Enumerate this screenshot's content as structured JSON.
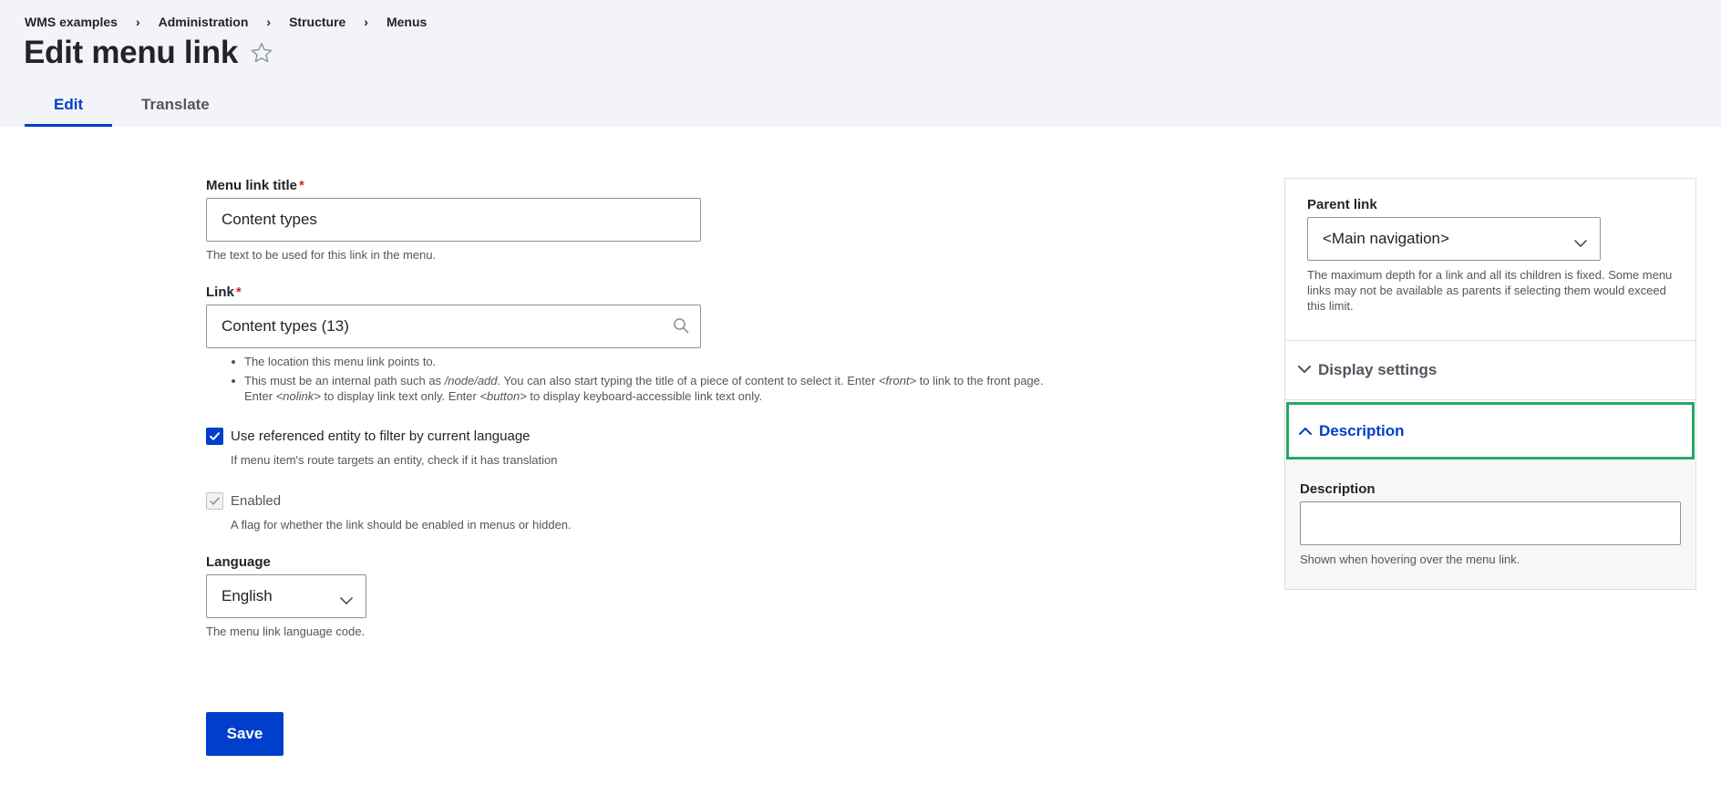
{
  "breadcrumb": [
    "WMS examples",
    "Administration",
    "Structure",
    "Menus"
  ],
  "breadcrumb_separator": "›",
  "page_title": "Edit menu link",
  "tabs": [
    {
      "label": "Edit",
      "active": true
    },
    {
      "label": "Translate",
      "active": false
    }
  ],
  "fields": {
    "title": {
      "label": "Menu link title",
      "required_mark": "*",
      "value": "Content types",
      "help": "The text to be used for this link in the menu."
    },
    "link": {
      "label": "Link",
      "required_mark": "*",
      "value": "Content types (13)",
      "help_items": [
        "The location this menu link points to.",
        "This must be an internal path such as /node/add. You can also start typing the title of a piece of content to select it. Enter <front> to link to the front page.",
        "Enter <nolink> to display link text only. Enter <button> to display keyboard-accessible link text only."
      ],
      "help_parts": {
        "line1": "The location this menu link points to.",
        "line2_a": "This must be an internal path such as ",
        "line2_em1": "/node/add",
        "line2_b": ". You can also start typing the title of a piece of content to select it. Enter ",
        "line2_em2": "<front>",
        "line2_c": " to link to the front page.",
        "line3_a": "Enter ",
        "line3_em1": "<nolink>",
        "line3_b": " to display link text only. Enter ",
        "line3_em2": "<button>",
        "line3_c": " to display keyboard-accessible link text only."
      }
    },
    "use_entity": {
      "label": "Use referenced entity to filter by current language",
      "checked": true,
      "help": "If menu item's route targets an entity, check if it has translation"
    },
    "enabled": {
      "label": "Enabled",
      "checked": true,
      "disabled": true,
      "help": "A flag for whether the link should be enabled in menus or hidden."
    },
    "language": {
      "label": "Language",
      "value": "English",
      "help": "The menu link language code."
    }
  },
  "save_label": "Save",
  "sidebar": {
    "parent_link": {
      "label": "Parent link",
      "value": "<Main navigation>",
      "help": "The maximum depth for a link and all its children is fixed. Some menu links may not be available as parents if selecting them would exceed this limit."
    },
    "display_settings": {
      "label": "Display settings",
      "expanded": false
    },
    "description": {
      "label": "Description",
      "expanded": true,
      "field_label": "Description",
      "value": "",
      "help": "Shown when hovering over the menu link."
    }
  },
  "colors": {
    "accent": "#003ecc",
    "focus_outline": "#26a769",
    "required": "#dc2323",
    "header_bg": "#f3f4f9"
  }
}
